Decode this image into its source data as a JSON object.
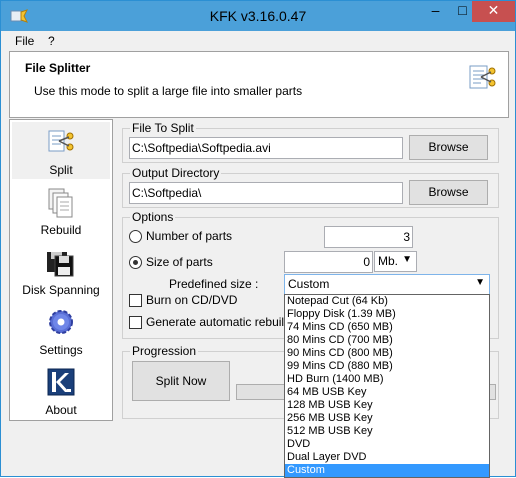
{
  "window": {
    "title": "KFK v3.16.0.47",
    "controls": {
      "minimize": "–",
      "maximize": "□",
      "close": "✕"
    }
  },
  "menu": {
    "items": [
      "File",
      "?"
    ]
  },
  "header": {
    "title": "File Splitter",
    "description": "Use this mode to split a large file into smaller parts"
  },
  "nav": {
    "items": [
      {
        "label": "Split",
        "icon": "split-icon",
        "active": true
      },
      {
        "label": "Rebuild",
        "icon": "documents-icon",
        "active": false
      },
      {
        "label": "Disk Spanning",
        "icon": "floppy-disk-icon",
        "active": false
      },
      {
        "label": "Settings",
        "icon": "gear-icon",
        "active": false
      },
      {
        "label": "About",
        "icon": "about-icon",
        "active": false
      }
    ]
  },
  "file_to_split": {
    "label": "File To Split",
    "value": "C:\\Softpedia\\Softpedia.avi",
    "browse_label": "Browse"
  },
  "output_directory": {
    "label": "Output Directory",
    "value": "C:\\Softpedia\\",
    "browse_label": "Browse"
  },
  "options": {
    "label": "Options",
    "number_of_parts_label": "Number of parts",
    "number_of_parts_value": "3",
    "size_of_parts_label": "Size of parts",
    "size_of_parts_value": "0",
    "size_unit": "Mb.",
    "predefined_size_label": "Predefined size :",
    "predefined_size_value": "Custom",
    "burn_label": "Burn on CD/DVD",
    "generate_label": "Generate automatic rebuild file"
  },
  "progression": {
    "label": "Progression",
    "split_now_label": "Split Now"
  },
  "dropdown_options": [
    "Notepad Cut (64 Kb)",
    "Floppy Disk (1.39 MB)",
    "74 Mins CD (650 MB)",
    "80 Mins CD (700 MB)",
    "90 Mins CD (800 MB)",
    "99 Mins CD (880 MB)",
    "HD Burn (1400 MB)",
    "64 MB USB Key",
    "128 MB USB Key",
    "256 MB USB Key",
    "512 MB USB Key",
    "DVD",
    "Dual Layer DVD",
    "Custom"
  ],
  "colors": {
    "titlebar": "#4ba0d9",
    "selection": "#3399ff",
    "close": "#c75050"
  }
}
